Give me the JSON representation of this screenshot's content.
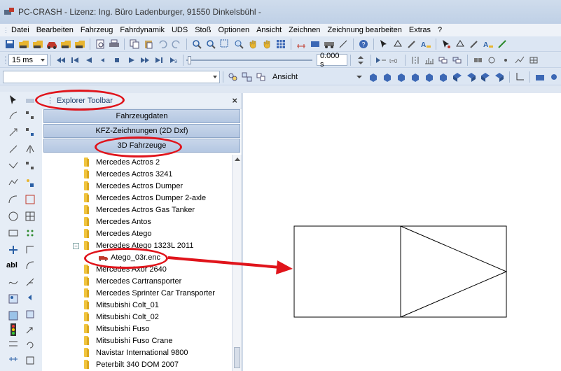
{
  "window": {
    "title": "PC-CRASH - Lizenz: Ing. Büro Ladenburger, 91550 Dinkelsbühl -"
  },
  "menubar": {
    "items": [
      "Datei",
      "Bearbeiten",
      "Fahrzeug",
      "Fahrdynamik",
      "UDS",
      "Stoß",
      "Optionen",
      "Ansicht",
      "Zeichnen",
      "Zeichnung bearbeiten",
      "Extras",
      "?"
    ]
  },
  "playbar": {
    "step_value": "15 ms",
    "time_value": "0.000 s"
  },
  "viewbar": {
    "view_label": "Ansicht"
  },
  "explorer": {
    "title": "Explorer Toolbar",
    "close_glyph": "×",
    "categories": [
      "Fahrzeugdaten",
      "KFZ-Zeichnungen (2D Dxf)",
      "3D Fahrzeuge"
    ],
    "tree": [
      {
        "label": "Mercedes Actros 2",
        "type": "folder"
      },
      {
        "label": "Mercedes Actros 3241",
        "type": "folder"
      },
      {
        "label": "Mercedes Actros Dumper",
        "type": "folder"
      },
      {
        "label": "Mercedes Actros Dumper 2-axle",
        "type": "folder"
      },
      {
        "label": "Mercedes Actros Gas Tanker",
        "type": "folder"
      },
      {
        "label": "Mercedes Antos",
        "type": "folder"
      },
      {
        "label": "Mercedes Atego",
        "type": "folder"
      },
      {
        "label": "Mercedes Atego 1323L 2011",
        "type": "folder-expanded"
      },
      {
        "label": "Atego_03r.enc",
        "type": "file"
      },
      {
        "label": "Mercedes Axor 2640",
        "type": "folder"
      },
      {
        "label": "Mercedes Cartransporter",
        "type": "folder"
      },
      {
        "label": "Mercedes Sprinter Car Transporter",
        "type": "folder"
      },
      {
        "label": "Mitsubishi Colt_01",
        "type": "folder"
      },
      {
        "label": "Mitsubishi Colt_02",
        "type": "folder"
      },
      {
        "label": "Mitsubishi Fuso",
        "type": "folder"
      },
      {
        "label": "Mitsubishi Fuso Crane",
        "type": "folder"
      },
      {
        "label": "Navistar International 9800",
        "type": "folder"
      },
      {
        "label": "Peterbilt 340 DOM 2007",
        "type": "folder"
      }
    ]
  },
  "toolcol": {
    "text_tool": "abl"
  },
  "colors": {
    "annotation": "#e0141b",
    "category_button": "#bccde5",
    "folder": "#f0c43f"
  }
}
